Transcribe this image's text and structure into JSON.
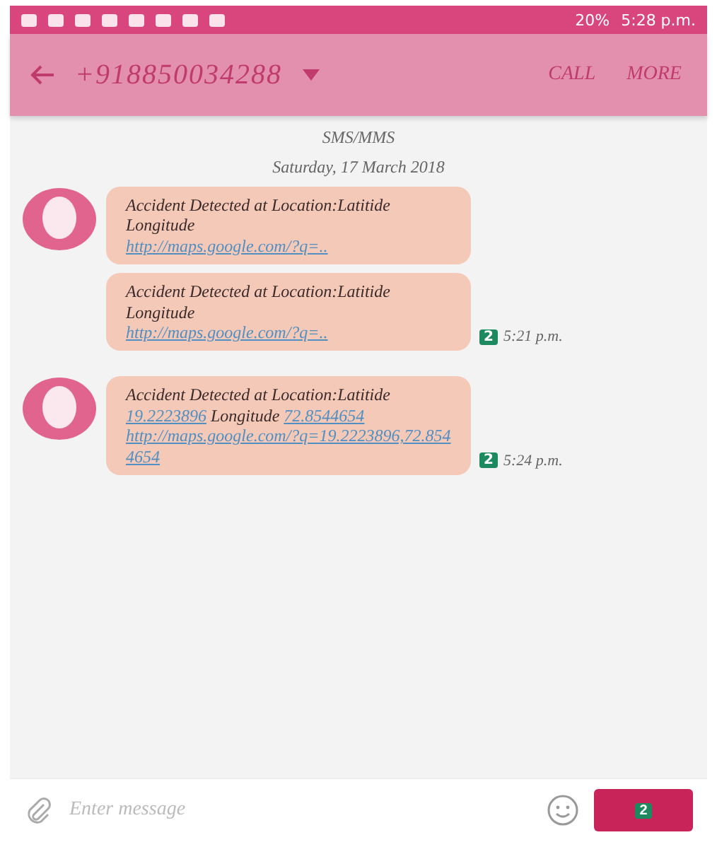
{
  "status_bar": {
    "battery": "20%",
    "time": "5:28 p.m."
  },
  "toolbar": {
    "title": "+918850034288",
    "actions": [
      "CALL",
      "MORE"
    ]
  },
  "thread": {
    "channel": "SMS/MMS",
    "date": "Saturday, 17 March 2018"
  },
  "messages": [
    {
      "avatar": true,
      "segments": [
        {
          "kind": "text",
          "text": "Accident Detected at Location:Latitide Longitude"
        }
      ],
      "url": "http://maps.google.com/?q=.."
    },
    {
      "avatar": false,
      "segments": [
        {
          "kind": "text",
          "text": "Accident Detected at Location:Latitide Longitude"
        }
      ],
      "url": "http://maps.google.com/?q=..",
      "sim": "2",
      "time": "5:21 p.m."
    },
    {
      "avatar": true,
      "segments": [
        {
          "kind": "text",
          "text": "Accident Detected at Location:Latitide"
        },
        {
          "kind": "link",
          "text": "19.2223896"
        },
        {
          "kind": "text",
          "text": "Longitude"
        },
        {
          "kind": "link",
          "text": "72.8544654"
        }
      ],
      "url": "http://maps.google.com/?q=19.2223896,72.8544654",
      "sim": "2",
      "time": "5:24 p.m."
    }
  ],
  "composer": {
    "placeholder": "Enter message",
    "send_sim": "2"
  }
}
